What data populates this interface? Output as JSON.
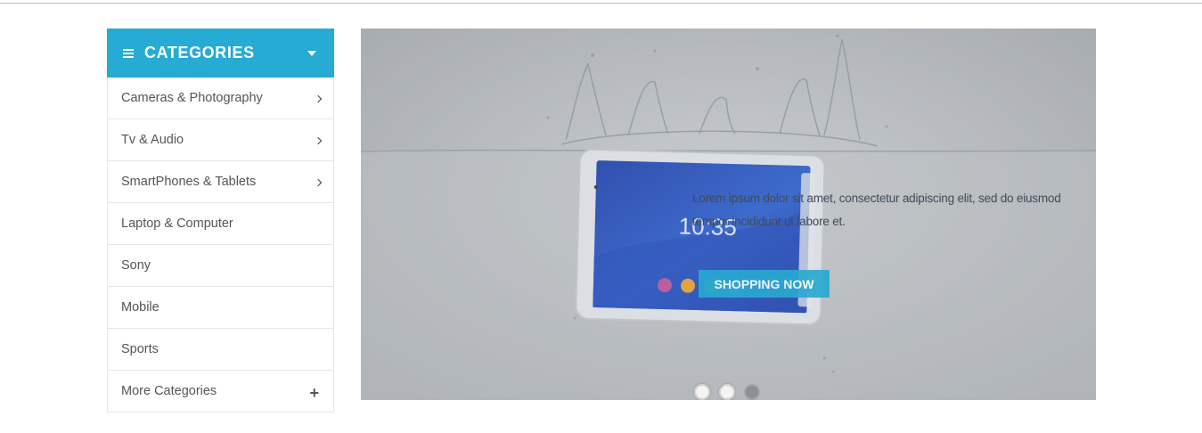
{
  "sidebar": {
    "title": "CATEGORIES",
    "items": [
      {
        "label": "Cameras & Photography",
        "has_submenu": true
      },
      {
        "label": "Tv & Audio",
        "has_submenu": true
      },
      {
        "label": "SmartPhones & Tablets",
        "has_submenu": true
      },
      {
        "label": "Laptop & Computer",
        "has_submenu": false
      },
      {
        "label": "Sony",
        "has_submenu": false
      },
      {
        "label": "Mobile",
        "has_submenu": false
      },
      {
        "label": "Sports",
        "has_submenu": false
      }
    ],
    "more_label": "More Categories",
    "accent_color": "#25abd4"
  },
  "slider": {
    "text": "Lorem ipsum dolor sit amet, consectetur adipiscing elit, sed do eiusmod tempor incididunt ut labore et.",
    "button_label": "SHOPPING NOW",
    "tablet_clock": "10:35",
    "active_slide": 3,
    "slide_count": 3
  }
}
